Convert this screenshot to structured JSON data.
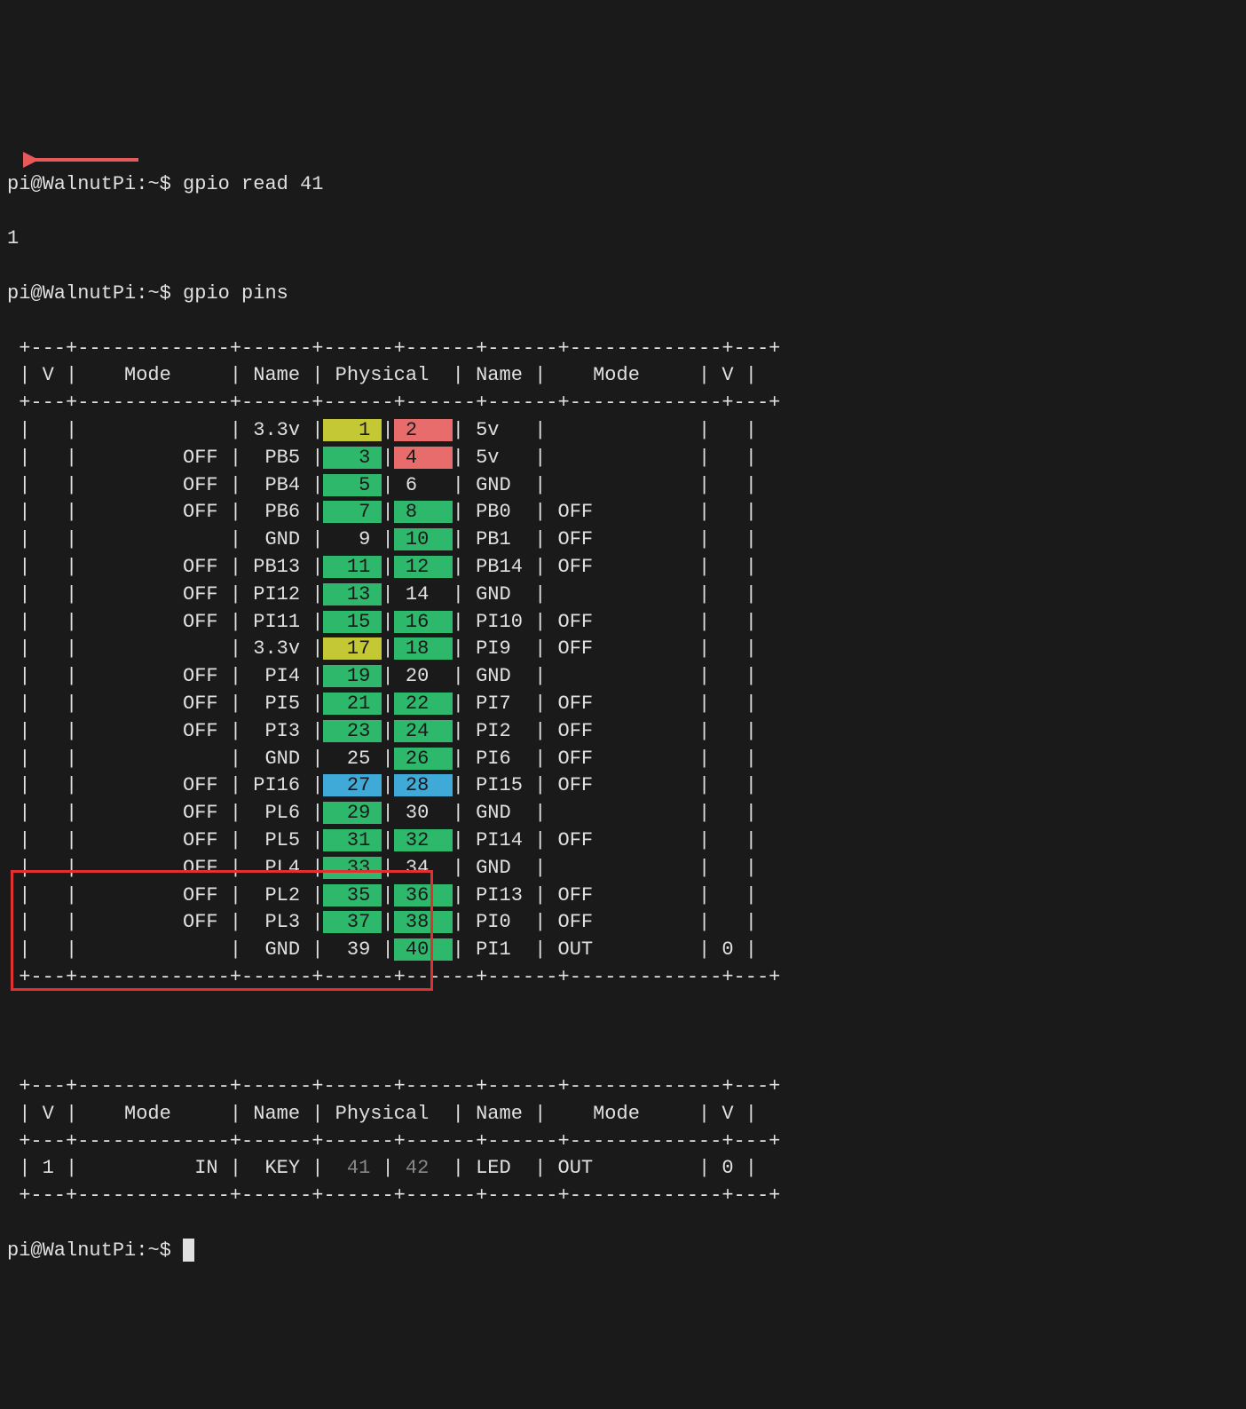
{
  "prompt1": {
    "user": "pi@WalnutPi",
    "path": "~",
    "symbol": "$",
    "cmd": "gpio read 41"
  },
  "output1": "1",
  "prompt2": {
    "user": "pi@WalnutPi",
    "path": "~",
    "symbol": "$",
    "cmd": "gpio pins"
  },
  "prompt3": {
    "user": "pi@WalnutPi",
    "path": "~",
    "symbol": "$"
  },
  "headers": [
    "V",
    "Mode",
    "Name",
    "Physical",
    "Name",
    "Mode",
    "V"
  ],
  "sep_top": "+---+----------+------+----+----+------+----------+---+",
  "rows": [
    {
      "lV": "",
      "lMode": "",
      "lName": "3.3v",
      "lPhys": "1",
      "lColor": "yellow",
      "rPhys": "2",
      "rColor": "red",
      "rName": "5v",
      "rMode": "",
      "rV": ""
    },
    {
      "lV": "",
      "lMode": "OFF",
      "lName": "PB5",
      "lPhys": "3",
      "lColor": "green",
      "rPhys": "4",
      "rColor": "red",
      "rName": "5v",
      "rMode": "",
      "rV": ""
    },
    {
      "lV": "",
      "lMode": "OFF",
      "lName": "PB4",
      "lPhys": "5",
      "lColor": "green",
      "rPhys": "6",
      "rColor": "black",
      "rName": "GND",
      "rMode": "",
      "rV": ""
    },
    {
      "lV": "",
      "lMode": "OFF",
      "lName": "PB6",
      "lPhys": "7",
      "lColor": "green",
      "rPhys": "8",
      "rColor": "green",
      "rName": "PB0",
      "rMode": "OFF",
      "rV": ""
    },
    {
      "lV": "",
      "lMode": "",
      "lName": "GND",
      "lPhys": "9",
      "lColor": "black",
      "rPhys": "10",
      "rColor": "green",
      "rName": "PB1",
      "rMode": "OFF",
      "rV": ""
    },
    {
      "lV": "",
      "lMode": "OFF",
      "lName": "PB13",
      "lPhys": "11",
      "lColor": "green",
      "rPhys": "12",
      "rColor": "green",
      "rName": "PB14",
      "rMode": "OFF",
      "rV": ""
    },
    {
      "lV": "",
      "lMode": "OFF",
      "lName": "PI12",
      "lPhys": "13",
      "lColor": "green",
      "rPhys": "14",
      "rColor": "black",
      "rName": "GND",
      "rMode": "",
      "rV": ""
    },
    {
      "lV": "",
      "lMode": "OFF",
      "lName": "PI11",
      "lPhys": "15",
      "lColor": "green",
      "rPhys": "16",
      "rColor": "green",
      "rName": "PI10",
      "rMode": "OFF",
      "rV": ""
    },
    {
      "lV": "",
      "lMode": "",
      "lName": "3.3v",
      "lPhys": "17",
      "lColor": "yellow",
      "rPhys": "18",
      "rColor": "green",
      "rName": "PI9",
      "rMode": "OFF",
      "rV": ""
    },
    {
      "lV": "",
      "lMode": "OFF",
      "lName": "PI4",
      "lPhys": "19",
      "lColor": "green",
      "rPhys": "20",
      "rColor": "black",
      "rName": "GND",
      "rMode": "",
      "rV": ""
    },
    {
      "lV": "",
      "lMode": "OFF",
      "lName": "PI5",
      "lPhys": "21",
      "lColor": "green",
      "rPhys": "22",
      "rColor": "green",
      "rName": "PI7",
      "rMode": "OFF",
      "rV": ""
    },
    {
      "lV": "",
      "lMode": "OFF",
      "lName": "PI3",
      "lPhys": "23",
      "lColor": "green",
      "rPhys": "24",
      "rColor": "green",
      "rName": "PI2",
      "rMode": "OFF",
      "rV": ""
    },
    {
      "lV": "",
      "lMode": "",
      "lName": "GND",
      "lPhys": "25",
      "lColor": "black",
      "rPhys": "26",
      "rColor": "green",
      "rName": "PI6",
      "rMode": "OFF",
      "rV": ""
    },
    {
      "lV": "",
      "lMode": "OFF",
      "lName": "PI16",
      "lPhys": "27",
      "lColor": "blue",
      "rPhys": "28",
      "rColor": "blue",
      "rName": "PI15",
      "rMode": "OFF",
      "rV": ""
    },
    {
      "lV": "",
      "lMode": "OFF",
      "lName": "PL6",
      "lPhys": "29",
      "lColor": "green",
      "rPhys": "30",
      "rColor": "black",
      "rName": "GND",
      "rMode": "",
      "rV": ""
    },
    {
      "lV": "",
      "lMode": "OFF",
      "lName": "PL5",
      "lPhys": "31",
      "lColor": "green",
      "rPhys": "32",
      "rColor": "green",
      "rName": "PI14",
      "rMode": "OFF",
      "rV": ""
    },
    {
      "lV": "",
      "lMode": "OFF",
      "lName": "PL4",
      "lPhys": "33",
      "lColor": "green",
      "rPhys": "34",
      "rColor": "black",
      "rName": "GND",
      "rMode": "",
      "rV": ""
    },
    {
      "lV": "",
      "lMode": "OFF",
      "lName": "PL2",
      "lPhys": "35",
      "lColor": "green",
      "rPhys": "36",
      "rColor": "green",
      "rName": "PI13",
      "rMode": "OFF",
      "rV": ""
    },
    {
      "lV": "",
      "lMode": "OFF",
      "lName": "PL3",
      "lPhys": "37",
      "lColor": "green",
      "rPhys": "38",
      "rColor": "green",
      "rName": "PI0",
      "rMode": "OFF",
      "rV": ""
    },
    {
      "lV": "",
      "lMode": "",
      "lName": "GND",
      "lPhys": "39",
      "lColor": "black",
      "rPhys": "40",
      "rColor": "green",
      "rName": "PI1",
      "rMode": "OUT",
      "rV": "0"
    }
  ],
  "rows2": [
    {
      "lV": "1",
      "lMode": "IN",
      "lName": "KEY",
      "lPhys": "41",
      "lColor": "none",
      "rPhys": "42",
      "rColor": "none",
      "rName": "LED",
      "rMode": "OUT",
      "rV": "0"
    }
  ]
}
